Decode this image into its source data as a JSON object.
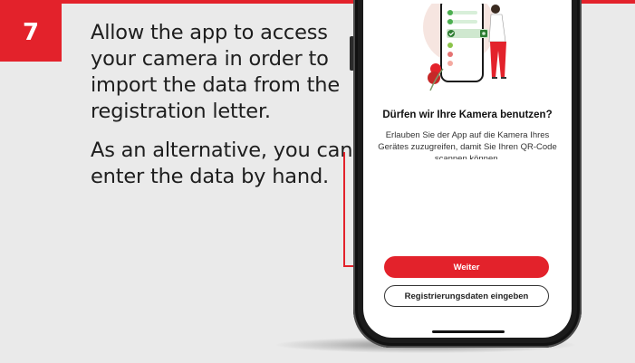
{
  "step": {
    "number": "7"
  },
  "instructions": {
    "paragraph1": "Allow the app to access your camera in order to import the data from the registration letter.",
    "paragraph2": "As an alternative, you can enter the data by hand."
  },
  "phone_screen": {
    "title": "Dürfen wir Ihre Kamera benutzen?",
    "body": "Erlauben Sie der App auf die Kamera Ihres Gerätes zuzugreifen, damit Sie Ihren QR-Code scannen können.",
    "primary_button": "Weiter",
    "secondary_button": "Registrierungsdaten eingeben"
  },
  "colors": {
    "accent": "#e3222b",
    "background": "#eaeaea",
    "text": "#1e1e1e",
    "illustration_green": "#4caf50"
  },
  "icons": [
    "step-number-badge",
    "pointer-arrow",
    "phone-camera-illustration",
    "check-icon",
    "camera-icon"
  ]
}
